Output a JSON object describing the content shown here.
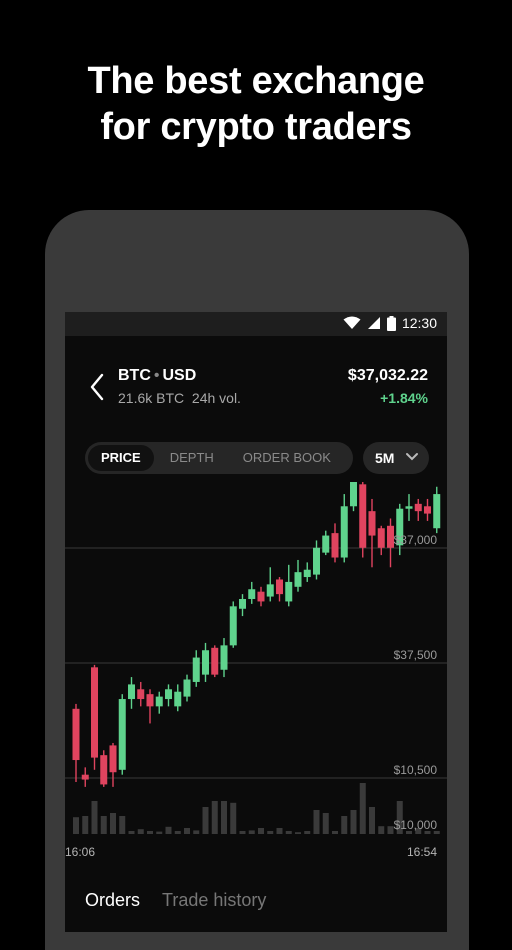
{
  "promo": {
    "headline_line1": "The best exchange",
    "headline_line2": "for crypto traders"
  },
  "status_bar": {
    "time": "12:30",
    "icons": [
      "wifi-icon",
      "cell-signal-icon",
      "battery-icon"
    ]
  },
  "pair": {
    "base": "BTC",
    "quote": "USD",
    "volume": "21.6k BTC  24h vol.",
    "price": "$37,032.22",
    "change": "+1.84%"
  },
  "chart_tabs": [
    {
      "label": "PRICE",
      "active": true
    },
    {
      "label": "DEPTH",
      "active": false
    },
    {
      "label": "ORDER BOOK",
      "active": false
    }
  ],
  "interval": {
    "label": "5M"
  },
  "colors": {
    "up": "#5fd38d",
    "down": "#e0445f",
    "grid": "#3a3a3a",
    "volume": "#3a3a3a"
  },
  "chart_data": {
    "type": "candlestick",
    "price_labels": [
      "$37,000",
      "$37,500",
      "$10,500",
      "$10,000"
    ],
    "x_labels": [
      "16:06",
      "16:54"
    ],
    "candles": [
      {
        "o": 0.3,
        "c": 0.09,
        "h": 0.32,
        "l": 0.0
      },
      {
        "o": 0.03,
        "c": 0.01,
        "h": 0.06,
        "l": -0.02
      },
      {
        "o": 0.47,
        "c": 0.1,
        "h": 0.48,
        "l": 0.05
      },
      {
        "o": 0.11,
        "c": -0.01,
        "h": 0.13,
        "l": -0.02
      },
      {
        "o": 0.15,
        "c": 0.04,
        "h": 0.16,
        "l": -0.02
      },
      {
        "o": 0.05,
        "c": 0.34,
        "h": 0.36,
        "l": 0.03
      },
      {
        "o": 0.34,
        "c": 0.4,
        "h": 0.43,
        "l": 0.3
      },
      {
        "o": 0.38,
        "c": 0.34,
        "h": 0.41,
        "l": 0.31
      },
      {
        "o": 0.36,
        "c": 0.31,
        "h": 0.38,
        "l": 0.24
      },
      {
        "o": 0.31,
        "c": 0.35,
        "h": 0.37,
        "l": 0.28
      },
      {
        "o": 0.34,
        "c": 0.38,
        "h": 0.4,
        "l": 0.31
      },
      {
        "o": 0.31,
        "c": 0.37,
        "h": 0.4,
        "l": 0.29
      },
      {
        "o": 0.35,
        "c": 0.42,
        "h": 0.44,
        "l": 0.33
      },
      {
        "o": 0.41,
        "c": 0.51,
        "h": 0.54,
        "l": 0.39
      },
      {
        "o": 0.44,
        "c": 0.54,
        "h": 0.57,
        "l": 0.41
      },
      {
        "o": 0.55,
        "c": 0.44,
        "h": 0.56,
        "l": 0.43
      },
      {
        "o": 0.46,
        "c": 0.56,
        "h": 0.59,
        "l": 0.43
      },
      {
        "o": 0.56,
        "c": 0.72,
        "h": 0.74,
        "l": 0.55
      },
      {
        "o": 0.71,
        "c": 0.75,
        "h": 0.77,
        "l": 0.68
      },
      {
        "o": 0.75,
        "c": 0.79,
        "h": 0.82,
        "l": 0.73
      },
      {
        "o": 0.78,
        "c": 0.74,
        "h": 0.8,
        "l": 0.72
      },
      {
        "o": 0.76,
        "c": 0.81,
        "h": 0.88,
        "l": 0.74
      },
      {
        "o": 0.83,
        "c": 0.77,
        "h": 0.84,
        "l": 0.74
      },
      {
        "o": 0.74,
        "c": 0.82,
        "h": 0.89,
        "l": 0.72
      },
      {
        "o": 0.8,
        "c": 0.86,
        "h": 0.91,
        "l": 0.78
      },
      {
        "o": 0.84,
        "c": 0.87,
        "h": 0.9,
        "l": 0.82
      },
      {
        "o": 0.85,
        "c": 0.96,
        "h": 0.99,
        "l": 0.83
      },
      {
        "o": 0.94,
        "c": 1.01,
        "h": 1.03,
        "l": 0.93
      },
      {
        "o": 1.02,
        "c": 0.92,
        "h": 1.06,
        "l": 0.9
      },
      {
        "o": 0.92,
        "c": 1.13,
        "h": 1.18,
        "l": 0.9
      },
      {
        "o": 1.13,
        "c": 1.23,
        "h": 1.26,
        "l": 1.11
      },
      {
        "o": 1.22,
        "c": 0.96,
        "h": 1.24,
        "l": 0.92
      },
      {
        "o": 1.11,
        "c": 1.01,
        "h": 1.16,
        "l": 0.88
      },
      {
        "o": 1.04,
        "c": 0.96,
        "h": 1.05,
        "l": 0.93
      },
      {
        "o": 1.05,
        "c": 0.96,
        "h": 1.08,
        "l": 0.88
      },
      {
        "o": 0.97,
        "c": 1.12,
        "h": 1.14,
        "l": 0.93
      },
      {
        "o": 1.12,
        "c": 1.13,
        "h": 1.18,
        "l": 1.07
      },
      {
        "o": 1.14,
        "c": 1.11,
        "h": 1.16,
        "l": 1.07
      },
      {
        "o": 1.13,
        "c": 1.1,
        "h": 1.16,
        "l": 1.07
      },
      {
        "o": 1.04,
        "c": 1.18,
        "h": 1.21,
        "l": 1.02
      }
    ],
    "volumes": [
      0.28,
      0.3,
      0.55,
      0.3,
      0.35,
      0.3,
      0.05,
      0.08,
      0.05,
      0.04,
      0.12,
      0.05,
      0.1,
      0.06,
      0.45,
      0.55,
      0.55,
      0.52,
      0.05,
      0.06,
      0.1,
      0.05,
      0.1,
      0.05,
      0.03,
      0.05,
      0.4,
      0.35,
      0.05,
      0.3,
      0.4,
      0.85,
      0.45,
      0.13,
      0.13,
      0.55,
      0.05,
      0.1,
      0.05,
      0.05
    ]
  },
  "bottom_tabs": [
    {
      "label": "Orders",
      "active": true
    },
    {
      "label": "Trade history",
      "active": false
    }
  ]
}
